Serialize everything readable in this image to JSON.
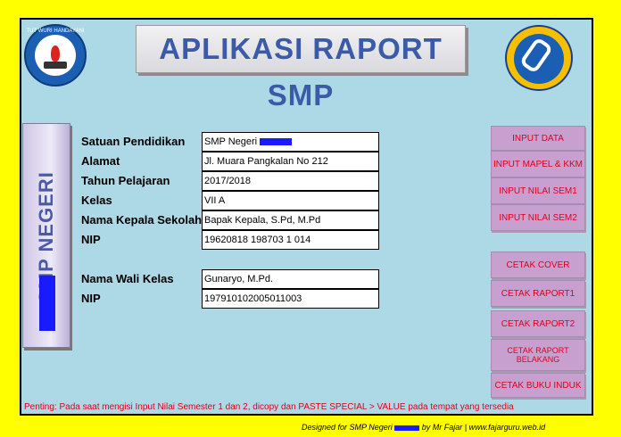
{
  "app": {
    "title": "APLIKASI RAPORT  SMP",
    "side_label": "SMP NEGERI",
    "left_logo_text": "TUT WURI HANDAYANI"
  },
  "form": {
    "rows": [
      {
        "label": "Satuan Pendidikan",
        "value": "SMP Negeri"
      },
      {
        "label": "Alamat",
        "value": "Jl. Muara Pangkalan No 212"
      },
      {
        "label": "Tahun Pelajaran",
        "value": "2017/2018"
      },
      {
        "label": "Kelas",
        "value": "VII A"
      },
      {
        "label": "Nama Kepala Sekolah",
        "value": "Bapak Kepala, S.Pd, M.Pd"
      },
      {
        "label": "NIP",
        "value": "19620818 198703 1 014"
      }
    ],
    "wali": [
      {
        "label": "Nama Wali Kelas",
        "value": "Gunaryo, M.Pd."
      },
      {
        "label": "NIP",
        "value": "197910102005011003"
      }
    ]
  },
  "menu": {
    "input": [
      "INPUT DATA",
      "INPUT MAPEL & KKM",
      "INPUT NILAI SEM1",
      "INPUT NILAI SEM2"
    ],
    "cetak": [
      "CETAK COVER",
      "CETAK RAPORT1",
      "CETAK RAPORT2",
      "CETAK RAPORT BELAKANG",
      "CETAK BUKU INDUK"
    ]
  },
  "note": "Penting: Pada saat mengisi Input Nilai Semester 1 dan 2, dicopy dan PASTE SPECIAL > VALUE  pada tempat yang tersedia",
  "footer": {
    "prefix": "Designed for SMP Negeri",
    "suffix": "by Mr Fajar  |  www.fajarguru.web.id"
  },
  "colors": {
    "background": "#ffff00",
    "panel": "#add8e6",
    "button": "#c8a0d0",
    "button_text": "#e0001b",
    "title_text": "#3b5aa8"
  }
}
